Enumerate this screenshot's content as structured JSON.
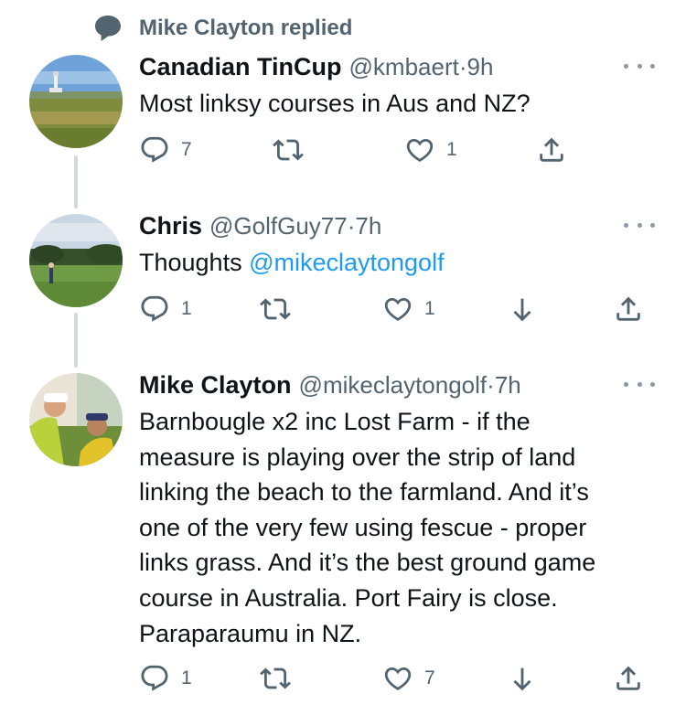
{
  "context": {
    "replied_text": "Mike Clayton replied",
    "icon": "speech-bubble-icon"
  },
  "tweets": [
    {
      "display_name": "Canadian TinCup",
      "handle": "@kmbaert",
      "sep": " · ",
      "time": "9h",
      "text": "Most linksy courses in Aus and NZ?",
      "replies": "7",
      "retweets": "",
      "likes": "1",
      "actions": [
        "reply",
        "retweet",
        "like",
        "share"
      ]
    },
    {
      "display_name": "Chris",
      "handle": "@GolfGuy77",
      "sep": " · ",
      "time": "7h",
      "text_prefix": "Thoughts ",
      "mention": "@mikeclaytongolf",
      "replies": "1",
      "retweets": "",
      "likes": "1",
      "actions": [
        "reply",
        "retweet",
        "like",
        "download",
        "share"
      ]
    },
    {
      "display_name": "Mike Clayton",
      "handle": "@mikeclaytongolf",
      "sep": " · ",
      "time": "7h",
      "lines": [
        "Barnbougle x2 inc Lost Farm -  if the",
        "measure is playing over the strip of land",
        "linking the beach to the farmland. And it’s",
        "one of the very few using fescue - proper",
        "links grass.  And it’s the best ground game",
        "course in Australia. Port Fairy is close.",
        "Paraparaumu in NZ."
      ],
      "replies": "1",
      "retweets": "",
      "likes": "7",
      "actions": [
        "reply",
        "retweet",
        "like",
        "download",
        "share"
      ]
    }
  ],
  "colors": {
    "text": "#0f1419",
    "secondary": "#536471",
    "link": "#1d9bf0",
    "thread_line": "#cfd9de"
  }
}
